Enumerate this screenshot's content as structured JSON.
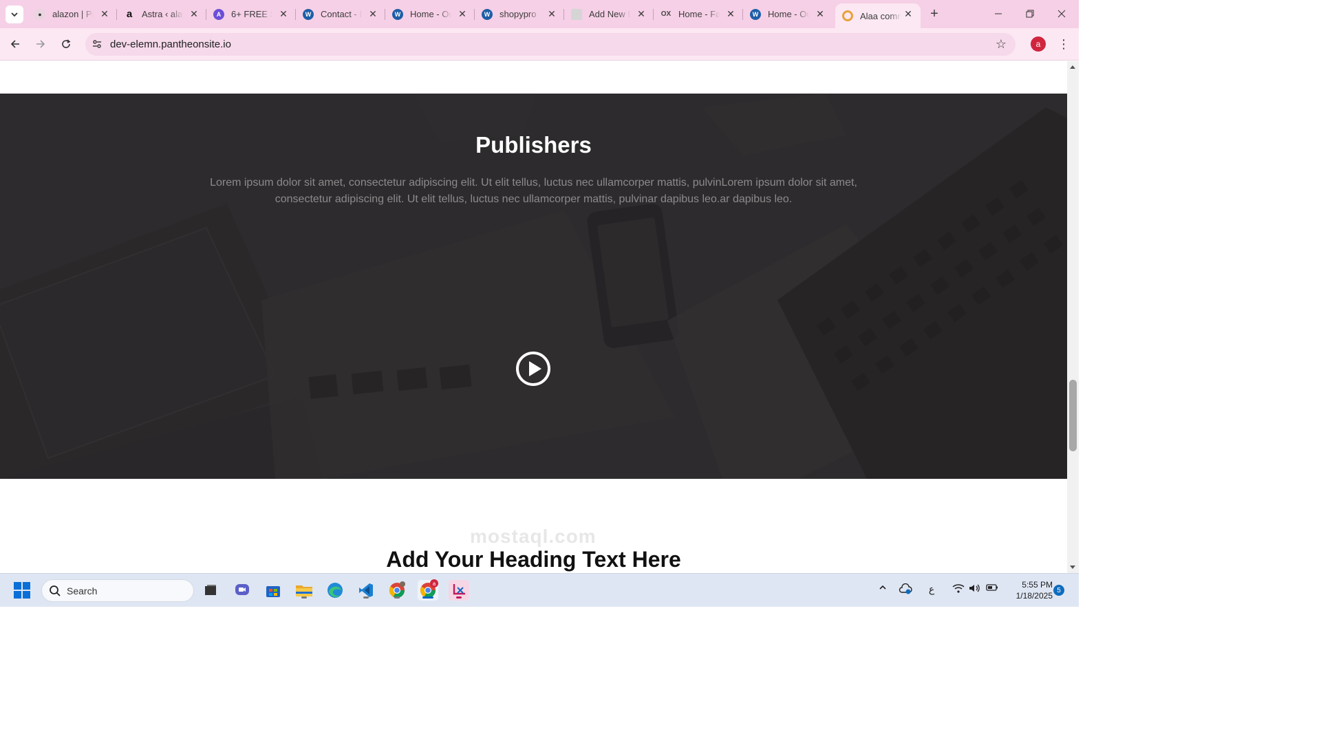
{
  "browser": {
    "tabs": [
      {
        "title": "alazon | Pa",
        "favicon": "generic-favicon",
        "color": "#333333"
      },
      {
        "title": "Astra ‹ alaz",
        "favicon": "amazon-icon",
        "color": "#222222"
      },
      {
        "title": "6+ FREE S",
        "favicon": "astra-icon",
        "color": "#6b4fd8"
      },
      {
        "title": "Contact - E",
        "favicon": "wordpress-icon",
        "color": "#1e5ea8"
      },
      {
        "title": "Home - Ou",
        "favicon": "wordpress-icon",
        "color": "#1e5ea8"
      },
      {
        "title": "shopypro",
        "favicon": "wordpress-icon",
        "color": "#1e5ea8"
      },
      {
        "title": "Add New E",
        "favicon": "page-icon",
        "color": "#8a8a8a"
      },
      {
        "title": "Home - Fa",
        "favicon": "ox-icon",
        "color": "#444444"
      },
      {
        "title": "Home - Ou",
        "favicon": "wordpress-icon",
        "color": "#1e5ea8"
      },
      {
        "title": "Alaa comm",
        "favicon": "ring-icon",
        "color": "#e8a23a"
      }
    ],
    "url": "dev-elemn.pantheonsite.io",
    "profile_initial": "a"
  },
  "page": {
    "hero_title": "Publishers",
    "hero_text": "Lorem ipsum dolor sit amet, consectetur adipiscing elit. Ut elit tellus, luctus nec ullamcorper mattis, pulvinLorem ipsum dolor sit amet, consectetur adipiscing elit. Ut elit tellus, luctus nec ullamcorper mattis, pulvinar dapibus leo.ar dapibus leo.",
    "heading": "Add Your Heading Text Here",
    "watermark": "mostaql.com"
  },
  "taskbar": {
    "search_label": "Search",
    "chrome_badge": "a",
    "keyboard_lang": "ع",
    "time": "5:55 PM",
    "date": "1/18/2025",
    "notifications": "5"
  },
  "colors": {
    "tab_strip": "#f6d0e6",
    "toolbar": "#fce8f3",
    "hero_bg": "#2f2d2e",
    "accent": "#0067c0"
  }
}
